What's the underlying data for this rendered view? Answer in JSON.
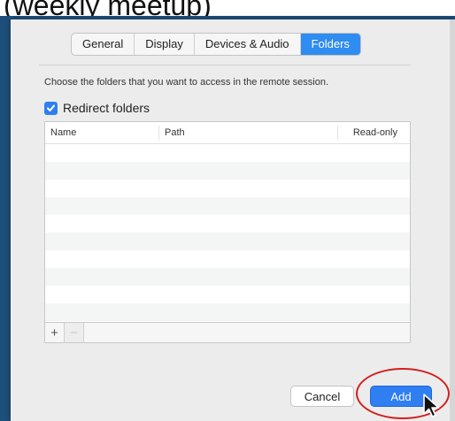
{
  "caption": {
    "text": "(weekly meetup)"
  },
  "dialog": {
    "tabs": [
      {
        "label": "General",
        "active": false
      },
      {
        "label": "Display",
        "active": false
      },
      {
        "label": "Devices & Audio",
        "active": false
      },
      {
        "label": "Folders",
        "active": true
      }
    ],
    "description": "Choose the folders that you want to access in the remote session.",
    "redirect_checkbox": {
      "label": "Redirect folders",
      "checked": true
    },
    "table": {
      "columns": [
        "Name",
        "Path",
        "Read-only"
      ],
      "rows": []
    },
    "table_actions": {
      "add_label": "+",
      "remove_label": "−"
    },
    "buttons": {
      "cancel_label": "Cancel",
      "add_label": "Add"
    }
  },
  "colors": {
    "accent": "#2f80ed",
    "annotation_ring": "#d21f1f",
    "background_frame": "#1d4f7a"
  },
  "icons": {
    "checkbox": "checkmark-icon",
    "cursor": "mouse-pointer-icon"
  }
}
